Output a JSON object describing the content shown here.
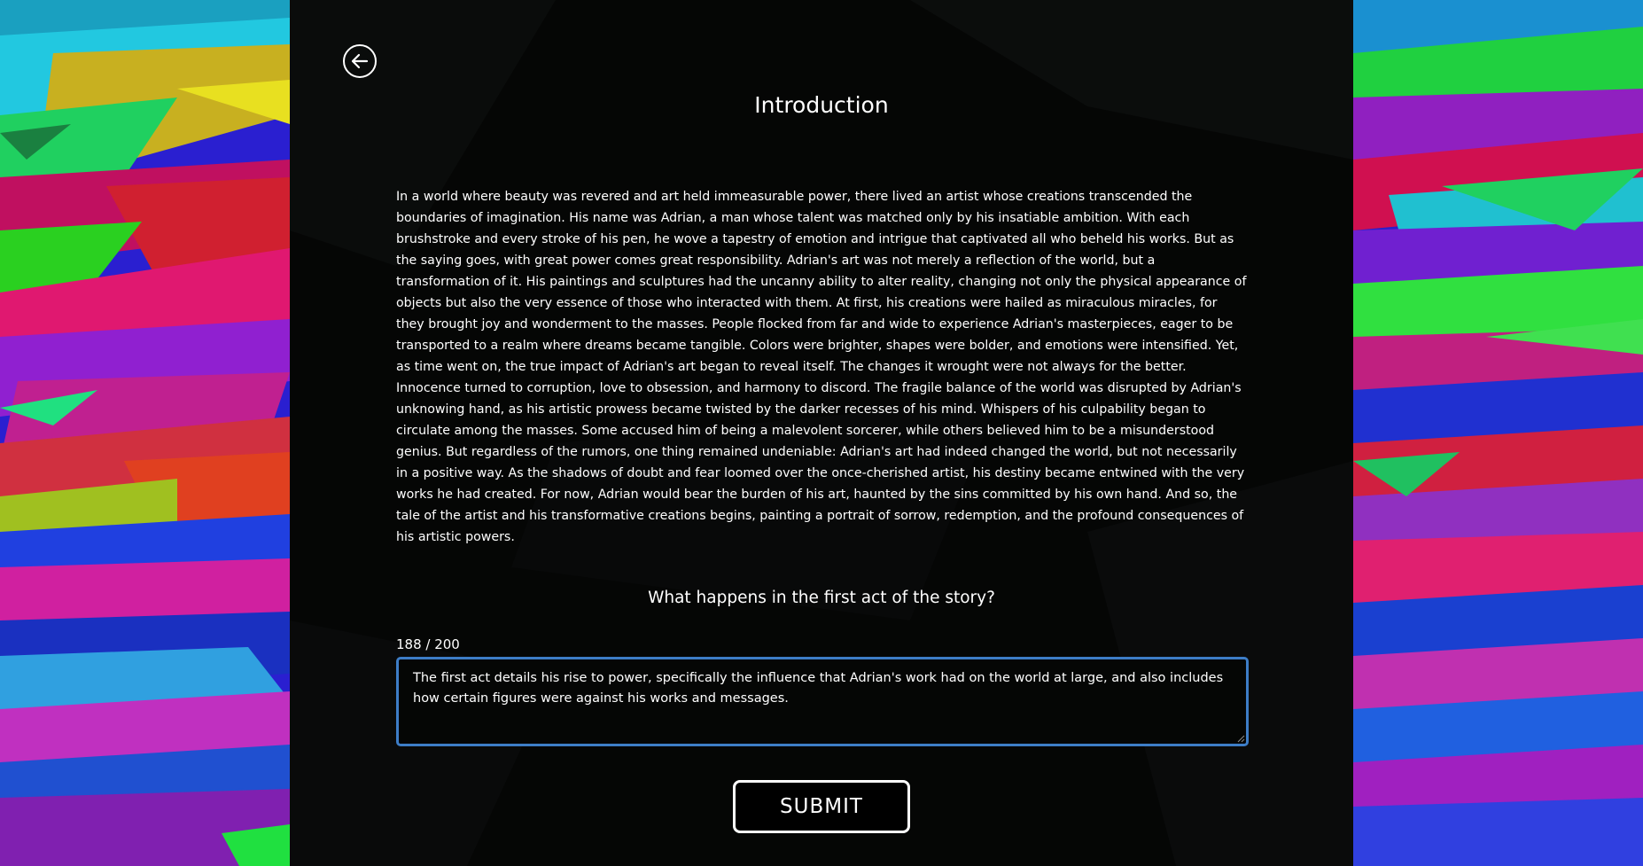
{
  "page": {
    "title": "Introduction",
    "back_icon": "arrow-left-icon",
    "story_text": "In a world where beauty was revered and art held immeasurable power, there lived an artist whose creations transcended the boundaries of imagination. His name was Adrian, a man whose talent was matched only by his insatiable ambition. With each brushstroke and every stroke of his pen, he wove a tapestry of emotion and intrigue that captivated all who beheld his works. But as the saying goes, with great power comes great responsibility. Adrian's art was not merely a reflection of the world, but a transformation of it. His paintings and sculptures had the uncanny ability to alter reality, changing not only the physical appearance of objects but also the very essence of those who interacted with them. At first, his creations were hailed as miraculous miracles, for they brought joy and wonderment to the masses. People flocked from far and wide to experience Adrian's masterpieces, eager to be transported to a realm where dreams became tangible. Colors were brighter, shapes were bolder, and emotions were intensified. Yet, as time went on, the true impact of Adrian's art began to reveal itself. The changes it wrought were not always for the better. Innocence turned to corruption, love to obsession, and harmony to discord. The fragile balance of the world was disrupted by Adrian's unknowing hand, as his artistic prowess became twisted by the darker recesses of his mind. Whispers of his culpability began to circulate among the masses. Some accused him of being a malevolent sorcerer, while others believed him to be a misunderstood genius. But regardless of the rumors, one thing remained undeniable: Adrian's art had indeed changed the world, but not necessarily in a positive way. As the shadows of doubt and fear loomed over the once-cherished artist, his destiny became entwined with the very works he had created. For now, Adrian would bear the burden of his art, haunted by the sins committed by his own hand. And so, the tale of the artist and his transformative creations begins, painting a portrait of sorrow, redemption, and the profound consequences of his artistic powers."
  },
  "form": {
    "question": "What happens in the first act of the story?",
    "char_count": "188 / 200",
    "answer_value": "The first act details his rise to power, specifically the influence that Adrian's work had on the world at large, and also includes how certain figures were against his works and messages.",
    "submit_label": "SUBMIT"
  },
  "colors": {
    "panel_background": "#050605",
    "text": "#ffffff",
    "input_focus_border": "#3d7dc7"
  }
}
